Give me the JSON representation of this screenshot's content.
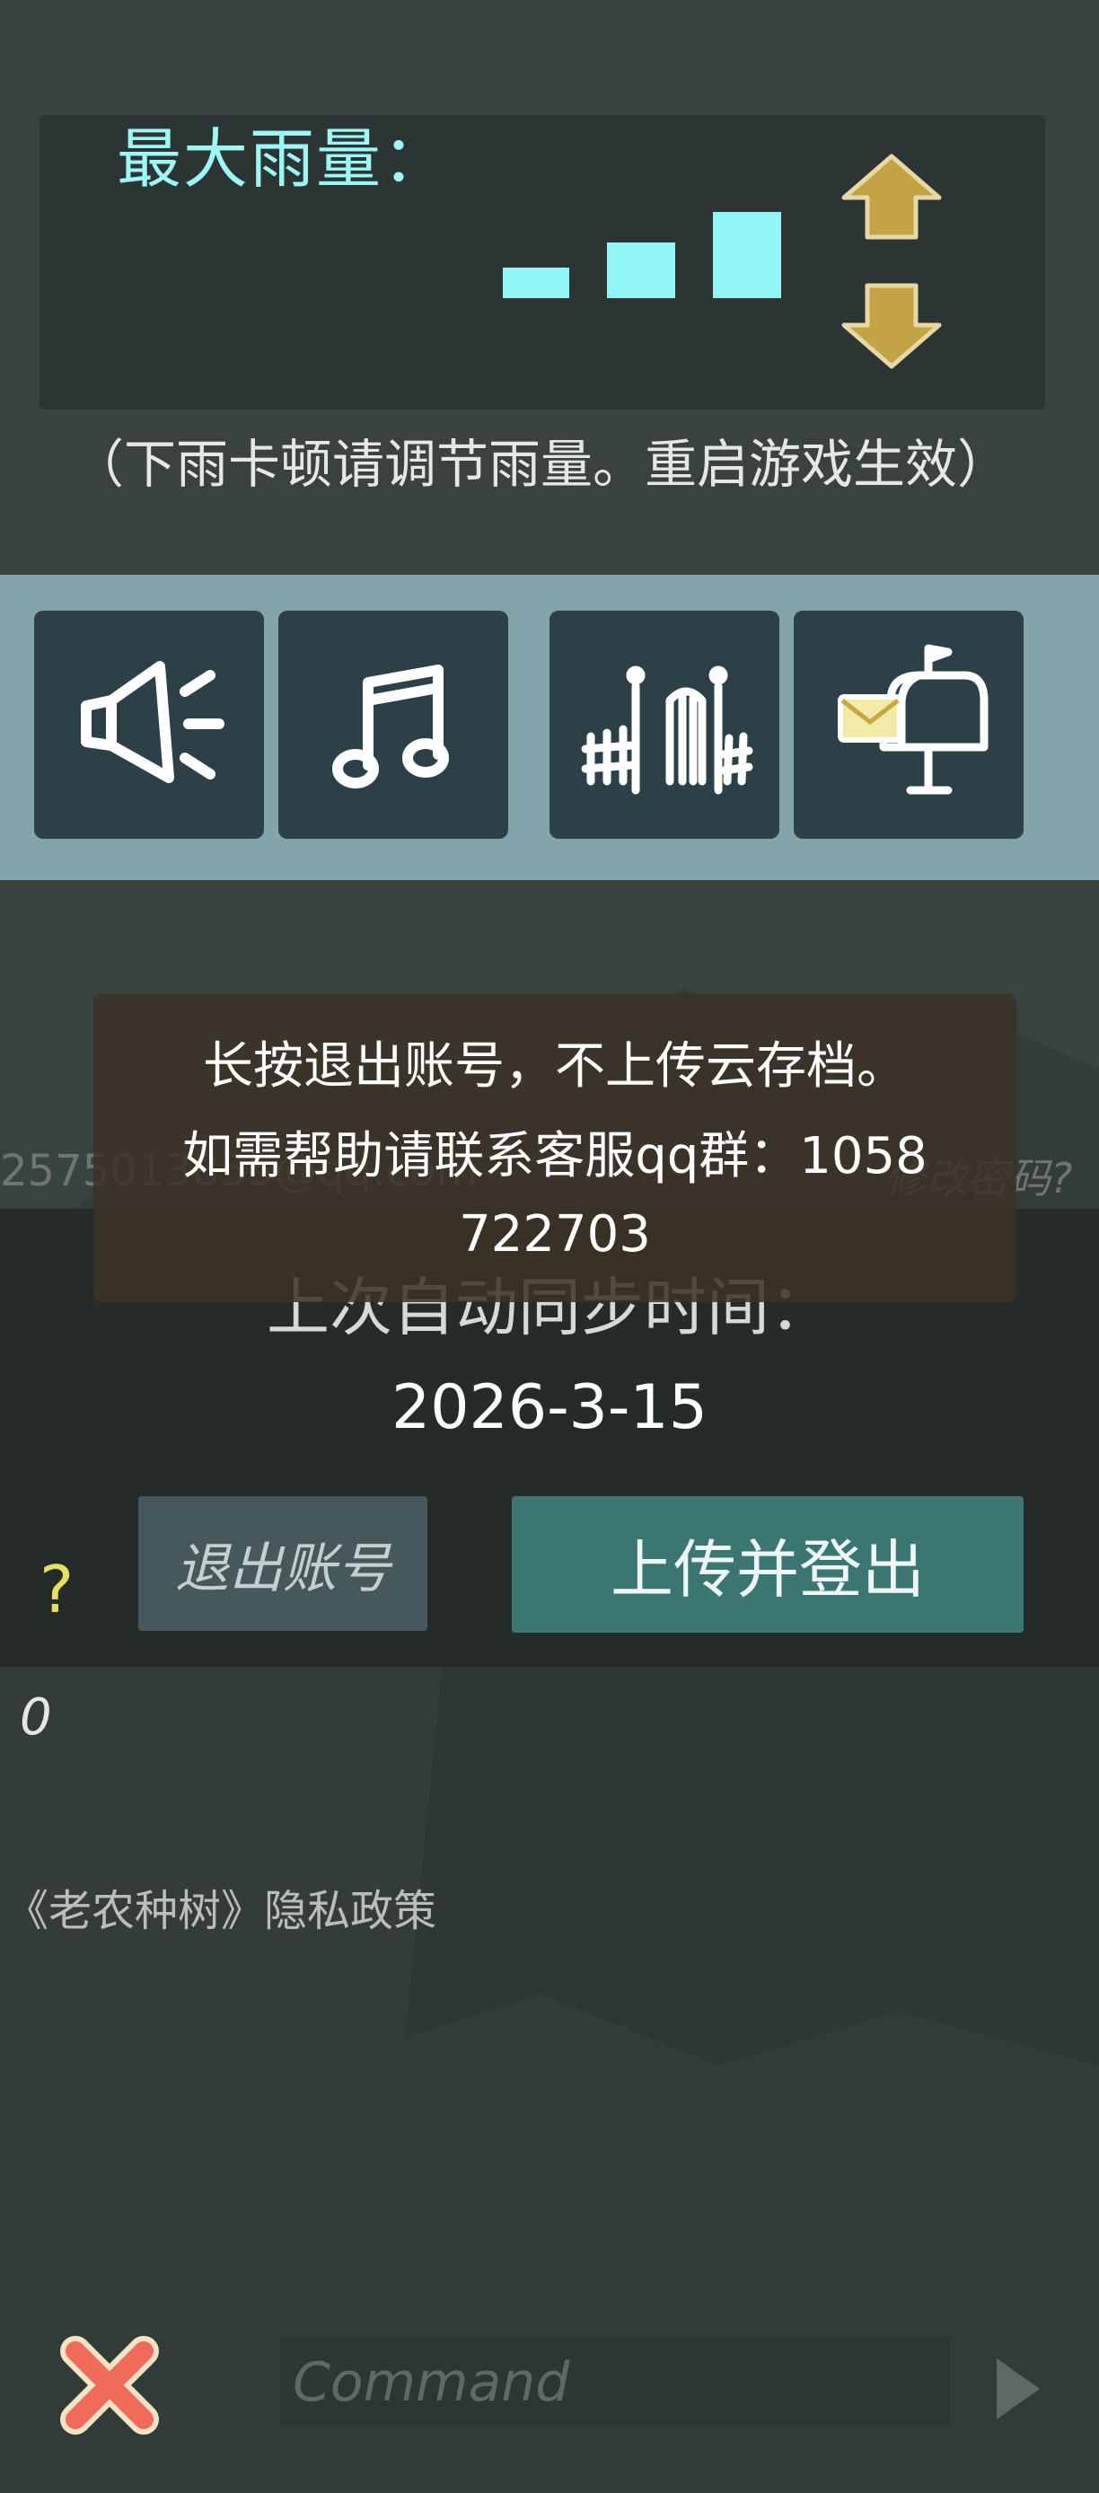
{
  "rain_settings": {
    "label": "最大雨量：",
    "note": "（下雨卡顿请调节雨量。重启游戏生效）"
  },
  "icon_bar": {
    "items": [
      {
        "icon": "speaker-icon"
      },
      {
        "icon": "music-note-icon"
      },
      {
        "icon": "fence-gate-icon"
      },
      {
        "icon": "mailbox-icon"
      }
    ]
  },
  "account": {
    "email": "2575013855@qq.com",
    "change_password": "修改密码?"
  },
  "tooltip": {
    "line1": "长按退出账号，不上传云存档。",
    "line2": "如需帮助请联系客服qq群：1058",
    "line3": "722703"
  },
  "sync": {
    "label": "上次自动同步时间：",
    "date": "2026-3-15"
  },
  "buttons": {
    "help": "?",
    "logout": "退出账号",
    "upload_logout": "上传并登出"
  },
  "counter": "0",
  "privacy_link": "《老农种树》隐私政策",
  "command": {
    "placeholder": "Command"
  },
  "colors": {
    "rain_bar": "#92f5f8",
    "arrow": "#c4a347",
    "icon_button": "#2d4047",
    "icon_strip": "#82a4aa",
    "upload_button": "#3c7672",
    "logout_button": "#46585a",
    "close_icon": "#f06b5c"
  }
}
